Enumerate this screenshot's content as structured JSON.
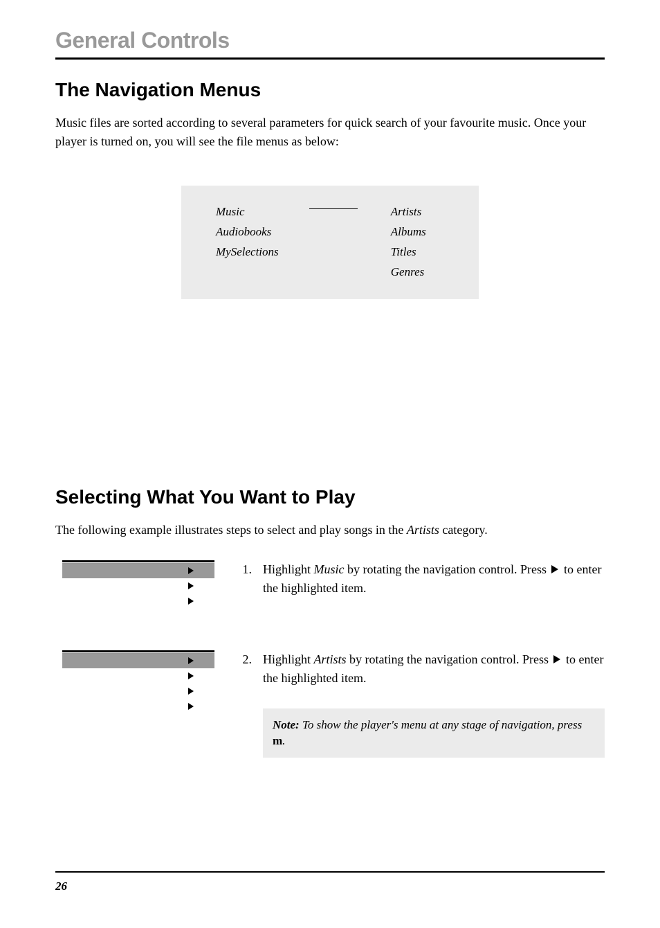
{
  "header": {
    "title": "General Controls"
  },
  "section1": {
    "heading": "The Navigation Menus",
    "paragraph": "Music files are sorted according to several parameters for quick search of your favourite music. Once your player is turned on, you will see the file menus as below:"
  },
  "menuDiagram": {
    "left": [
      "Music",
      "Audiobooks",
      "MySelections"
    ],
    "right": [
      "Artists",
      "Albums",
      "Titles",
      "Genres"
    ]
  },
  "section2": {
    "heading": "Selecting What You Want to Play",
    "paragraph_prefix": "The following example illustrates steps to select and play songs in the ",
    "paragraph_italic": "Artists",
    "paragraph_suffix": " category."
  },
  "steps": [
    {
      "num": "1.",
      "prefix": "Highlight ",
      "italic": "Music",
      "mid": " by rotating the navigation control. Press ",
      "suffix": " to enter the highlighted item.",
      "screenRows": 3
    },
    {
      "num": "2.",
      "prefix": "Highlight ",
      "italic": "Artists",
      "mid": " by rotating the navigation control. Press ",
      "suffix": " to enter the highlighted item.",
      "screenRows": 4
    }
  ],
  "note": {
    "label": "Note:",
    "text_part1": " To show the player's menu at any stage of navigation, press ",
    "m": "m",
    "text_part2": "."
  },
  "footer": {
    "pageNum": "26"
  }
}
